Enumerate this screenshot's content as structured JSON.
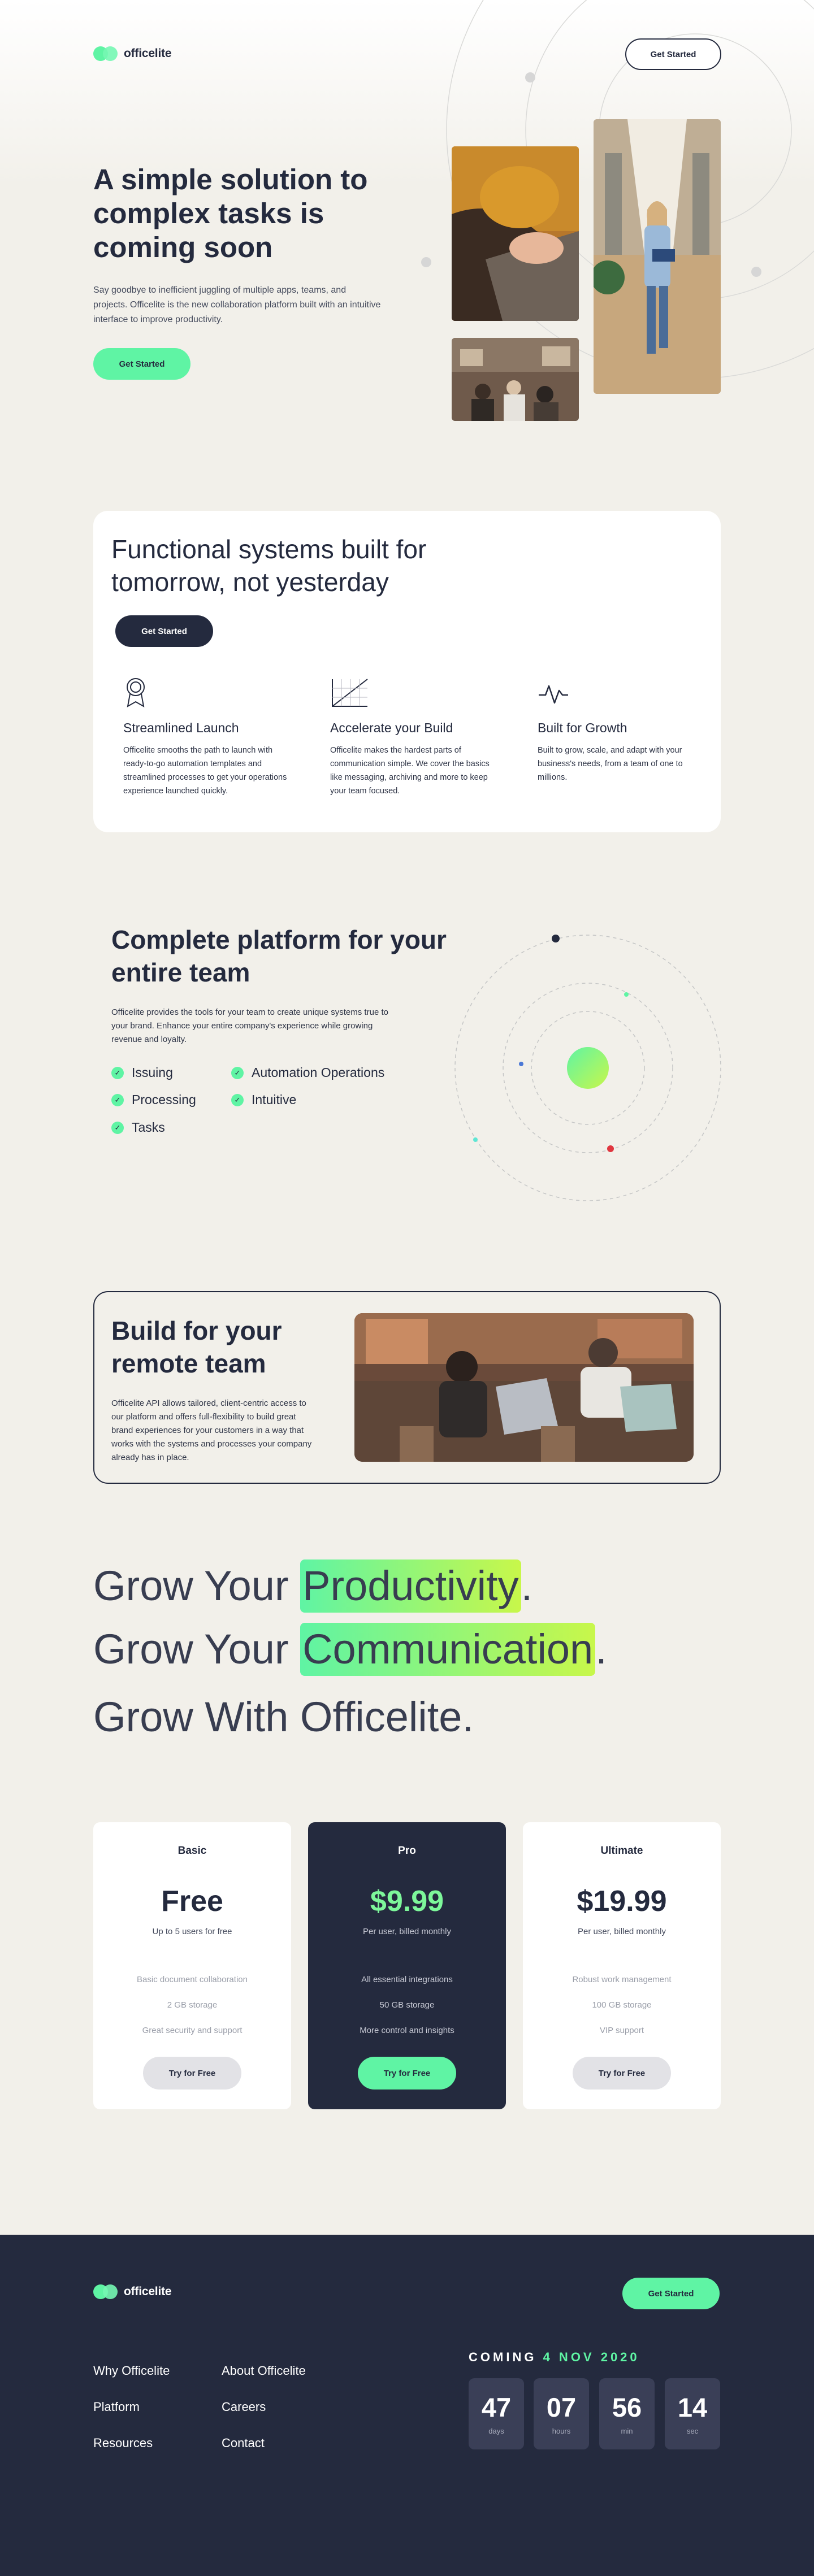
{
  "brand": {
    "name": "officelite",
    "accent": "#5ff4a4",
    "dark": "#242a3e",
    "background": "#f2f0ea"
  },
  "header": {
    "cta": "Get Started"
  },
  "hero": {
    "title": "A simple solution to complex tasks is coming soon",
    "text": "Say goodbye to inefficient juggling of multiple apps, teams, and projects. Officelite is the new collaboration platform built with an intuitive interface to improve productivity.",
    "cta": "Get Started",
    "photos": [
      "typing-on-laptop-photo",
      "woman-walking-office-photo",
      "team-meeting-photo"
    ]
  },
  "features": {
    "title": "Functional systems built for tomorrow, not yesterday",
    "cta": "Get Started",
    "items": [
      {
        "icon": "award-icon",
        "title": "Streamlined Launch",
        "text": "Officelite smooths the path to launch with ready-to-go automation templates and streamlined processes to get your operations experience launched quickly."
      },
      {
        "icon": "chart-icon",
        "title": "Accelerate your Build",
        "text": "Officelite makes the hardest parts of communication simple. We cover the basics like messaging, archiving and more to keep your team focused."
      },
      {
        "icon": "pulse-icon",
        "title": "Built for Growth",
        "text": "Built to grow, scale, and adapt with your business's needs, from a team of one to millions."
      }
    ]
  },
  "platform": {
    "title": "Complete platform for your entire team",
    "text": "Officelite provides the tools for your team to create unique systems true to your brand. Enhance your entire company's experience while growing revenue and loyalty.",
    "checks": [
      "Issuing",
      "Automation Operations",
      "Processing",
      "Intuitive",
      "Tasks"
    ]
  },
  "remote": {
    "title": "Build for your remote team",
    "text": "Officelite API allows tailored, client-centric access to our platform and offers full-flexibility to build great brand experiences for your customers in a way that works with the systems and processes your company already has in place."
  },
  "grow": {
    "lines": [
      {
        "prefix": "Grow Your ",
        "highlight": "Productivity",
        "suffix": "."
      },
      {
        "prefix": "Grow Your ",
        "highlight": "Communication",
        "suffix": "."
      },
      {
        "prefix": "Grow With Officelite.",
        "highlight": "",
        "suffix": ""
      }
    ]
  },
  "pricing": [
    {
      "plan": "Basic",
      "price": "Free",
      "sub": "Up to 5 users for free",
      "features": [
        "Basic document collaboration",
        "2 GB storage",
        "Great security and support"
      ],
      "cta": "Try for Free"
    },
    {
      "plan": "Pro",
      "price": "$9.99",
      "sub": "Per user, billed monthly",
      "features": [
        "All essential integrations",
        "50 GB storage",
        "More control and insights"
      ],
      "cta": "Try for Free"
    },
    {
      "plan": "Ultimate",
      "price": "$19.99",
      "sub": "Per user, billed monthly",
      "features": [
        "Robust work management",
        "100 GB storage",
        "VIP support"
      ],
      "cta": "Try for Free"
    }
  ],
  "footer": {
    "cta": "Get Started",
    "links": [
      "Why Officelite",
      "About Officelite",
      "Platform",
      "Careers",
      "Resources",
      "Contact"
    ],
    "coming_label": "COMING",
    "coming_date": "4 NOV 2020",
    "countdown": [
      {
        "value": "47",
        "unit": "days"
      },
      {
        "value": "07",
        "unit": "hours"
      },
      {
        "value": "56",
        "unit": "min"
      },
      {
        "value": "14",
        "unit": "sec"
      }
    ]
  }
}
